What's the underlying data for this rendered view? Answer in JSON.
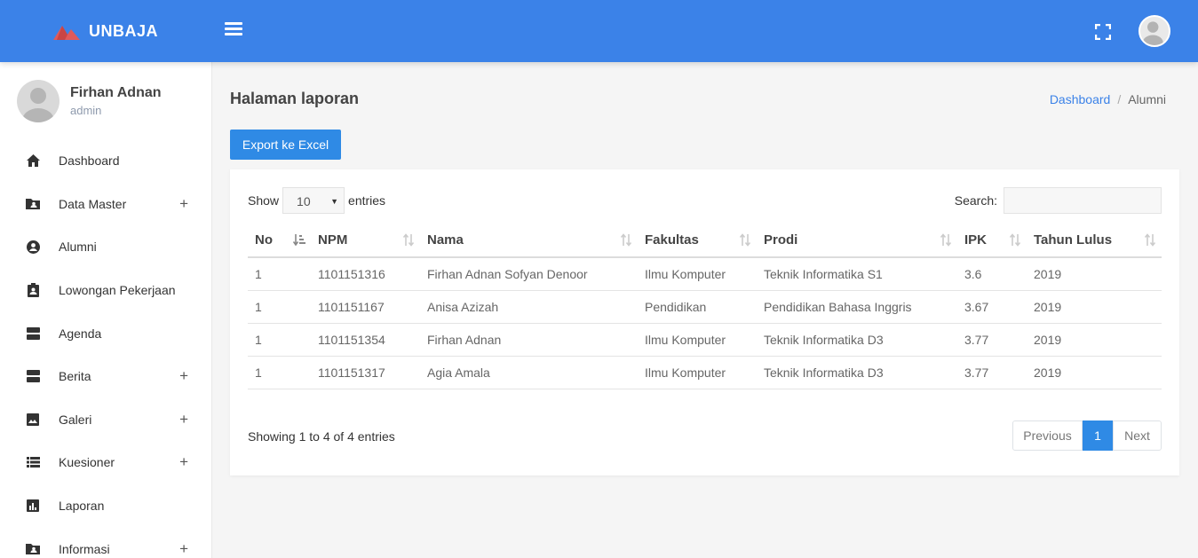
{
  "brand": {
    "name": "UNBAJA",
    "logo_color": "#e05a5a"
  },
  "user": {
    "name": "Firhan Adnan",
    "role": "admin"
  },
  "sidebar": {
    "items": [
      {
        "label": "Dashboard",
        "icon": "home-icon",
        "expandable": false
      },
      {
        "label": "Data Master",
        "icon": "folder-user-icon",
        "expandable": true,
        "plus": "+"
      },
      {
        "label": "Alumni",
        "icon": "user-circle-icon",
        "expandable": false
      },
      {
        "label": "Lowongan Pekerjaan",
        "icon": "clipboard-user-icon",
        "expandable": false
      },
      {
        "label": "Agenda",
        "icon": "view-agenda-icon",
        "expandable": false
      },
      {
        "label": "Berita",
        "icon": "view-agenda-icon",
        "expandable": true,
        "plus": "+"
      },
      {
        "label": "Galeri",
        "icon": "image-icon",
        "expandable": true,
        "plus": "+"
      },
      {
        "label": "Kuesioner",
        "icon": "list-icon",
        "expandable": true,
        "plus": "+"
      },
      {
        "label": "Laporan",
        "icon": "bar-chart-icon",
        "expandable": false
      },
      {
        "label": "Informasi",
        "icon": "folder-user-icon",
        "expandable": true,
        "plus": "+"
      }
    ]
  },
  "main": {
    "title": "Halaman laporan",
    "breadcrumb": {
      "link": "Dashboard",
      "separator": "/",
      "current": "Alumni"
    },
    "export_label": "Export ke Excel",
    "show_label": "Show",
    "entries_value": "10",
    "entries_label": "entries",
    "search_label": "Search:",
    "table": {
      "columns": [
        "No",
        "NPM",
        "Nama",
        "Fakultas",
        "Prodi",
        "IPK",
        "Tahun Lulus"
      ],
      "rows": [
        [
          "1",
          "1101151316",
          "Firhan Adnan Sofyan Denoor",
          "Ilmu Komputer",
          "Teknik Informatika S1",
          "3.6",
          "2019"
        ],
        [
          "1",
          "1101151167",
          "Anisa Azizah",
          "Pendidikan",
          "Pendidikan Bahasa Inggris",
          "3.67",
          "2019"
        ],
        [
          "1",
          "1101151354",
          "Firhan Adnan",
          "Ilmu Komputer",
          "Teknik Informatika D3",
          "3.77",
          "2019"
        ],
        [
          "1",
          "1101151317",
          "Agia Amala",
          "Ilmu Komputer",
          "Teknik Informatika D3",
          "3.77",
          "2019"
        ]
      ]
    },
    "info": "Showing 1 to 4 of 4 entries",
    "pagination": {
      "previous": "Previous",
      "current": "1",
      "next": "Next"
    }
  },
  "colors": {
    "primary": "#3b82e8",
    "button": "#2f8ae5"
  }
}
